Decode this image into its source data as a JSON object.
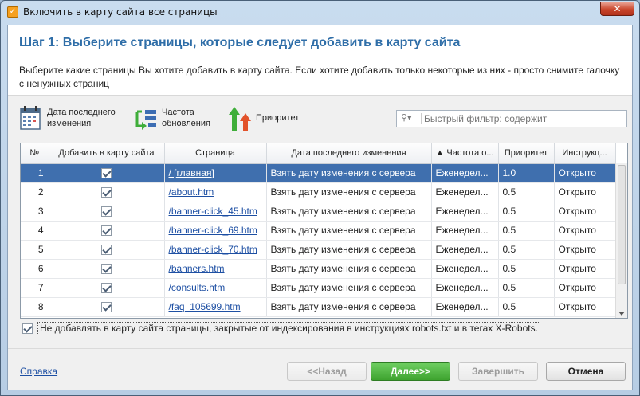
{
  "window": {
    "title": "Включить в карту сайта все страницы",
    "close_label": "✕"
  },
  "header": {
    "step_title": "Шаг 1: Выберите страницы, которые следует добавить в карту сайта",
    "description": "Выберите какие страницы Вы хотите добавить в карту сайта. Если хотите добавить только некоторые из них - просто снимите галочку с ненужных страниц"
  },
  "toolbar": {
    "date_label": "Дата последнего\nизменения",
    "freq_label": "Частота\nобновления",
    "priority_label": "Приоритет",
    "filter_placeholder": "Быстрый фильтр: содержит"
  },
  "table": {
    "columns": [
      "№",
      "Добавить в карту сайта",
      "Страница",
      "Дата последнего изменения",
      "▲ Частота о...",
      "Приоритет",
      "Инструкц..."
    ],
    "rows": [
      {
        "num": "1",
        "page": "/   [главная]",
        "date": "Взять дату изменения с сервера",
        "freq": "Еженедел...",
        "priority": "1.0",
        "robots": "Открыто"
      },
      {
        "num": "2",
        "page": "/about.htm",
        "date": "Взять дату изменения с сервера",
        "freq": "Еженедел...",
        "priority": "0.5",
        "robots": "Открыто"
      },
      {
        "num": "3",
        "page": "/banner-click_45.htm",
        "date": "Взять дату изменения с сервера",
        "freq": "Еженедел...",
        "priority": "0.5",
        "robots": "Открыто"
      },
      {
        "num": "4",
        "page": "/banner-click_69.htm",
        "date": "Взять дату изменения с сервера",
        "freq": "Еженедел...",
        "priority": "0.5",
        "robots": "Открыто"
      },
      {
        "num": "5",
        "page": "/banner-click_70.htm",
        "date": "Взять дату изменения с сервера",
        "freq": "Еженедел...",
        "priority": "0.5",
        "robots": "Открыто"
      },
      {
        "num": "6",
        "page": "/banners.htm",
        "date": "Взять дату изменения с сервера",
        "freq": "Еженедел...",
        "priority": "0.5",
        "robots": "Открыто"
      },
      {
        "num": "7",
        "page": "/consults.htm",
        "date": "Взять дату изменения с сервера",
        "freq": "Еженедел...",
        "priority": "0.5",
        "robots": "Открыто"
      },
      {
        "num": "8",
        "page": "/faq_105699.htm",
        "date": "Взять дату изменения с сервера",
        "freq": "Еженедел...",
        "priority": "0.5",
        "robots": "Открыто"
      }
    ]
  },
  "robots_checkbox_label": "Не добавлять в карту сайта страницы, закрытые от индексирования в инструкциях robots.txt и в тегах X-Robots.",
  "footer": {
    "help_link": "Справка",
    "back_button": "<<Назад",
    "next_button": "Далее>>",
    "finish_button": "Завершить",
    "cancel_button": "Отмена"
  },
  "colors": {
    "title_blue": "#2f6ea8",
    "selected_row": "#3f6fae",
    "next_green": "#3ea32f"
  }
}
